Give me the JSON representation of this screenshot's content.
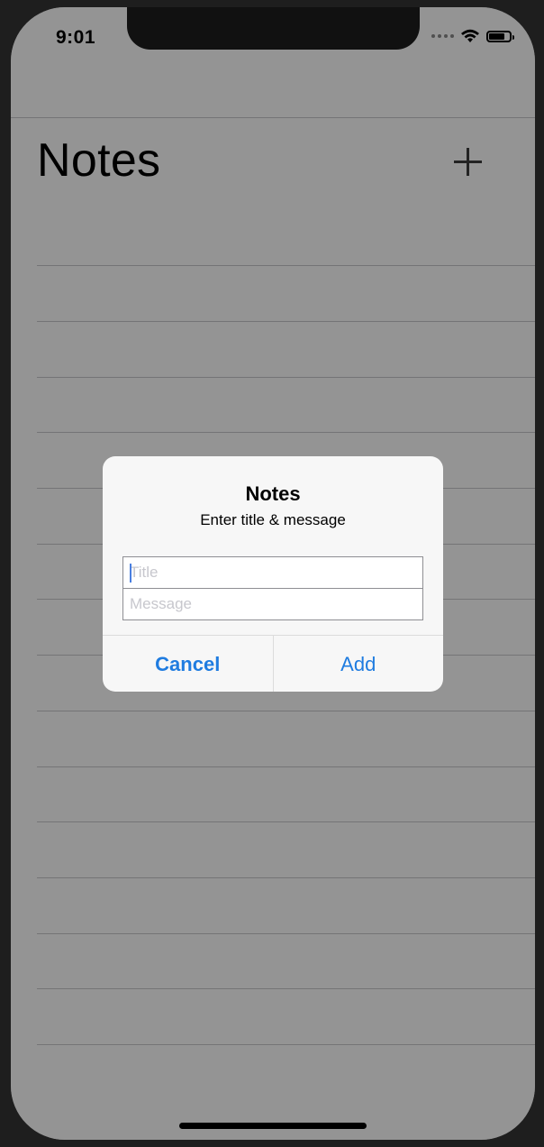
{
  "status_bar": {
    "time": "9:01"
  },
  "navigation": {
    "title": "Notes",
    "add_icon": "plus-icon"
  },
  "alert": {
    "title": "Notes",
    "message": "Enter title & message",
    "title_placeholder": "Title",
    "message_placeholder": "Message",
    "cancel_label": "Cancel",
    "add_label": "Add"
  },
  "colors": {
    "accent": "#1f7ce0",
    "overlay": "rgba(0,0,0,0.42)"
  }
}
